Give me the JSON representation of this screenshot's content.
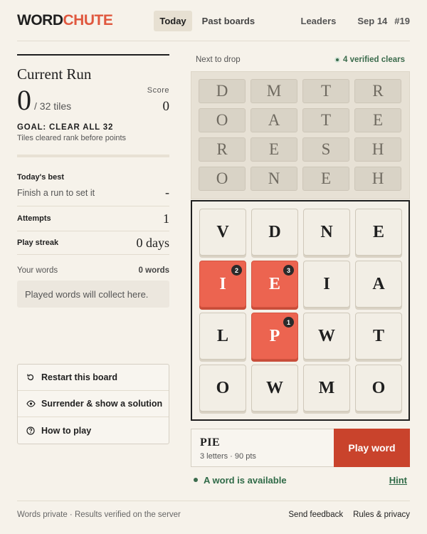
{
  "brand": {
    "word": "WORD",
    "chute": "CHUTE"
  },
  "nav": {
    "today": "Today",
    "past": "Past boards"
  },
  "header": {
    "leaders": "Leaders",
    "date": "Sep 14",
    "number": "#19"
  },
  "run": {
    "title": "Current Run",
    "cleared": "0",
    "of_total": "/ 32 tiles",
    "score_label": "Score",
    "score": "0",
    "goal": "GOAL: CLEAR ALL 32",
    "goal_sub": "Tiles cleared rank before points",
    "progress": 0
  },
  "stats": {
    "best_label": "Today's best",
    "best_sub": "Finish a run to set it",
    "best_value": "-",
    "attempts_label": "Attempts",
    "attempts_value": "1",
    "streak_label": "Play streak",
    "streak_value": "0 days"
  },
  "words": {
    "label": "Your words",
    "count": "0 words",
    "empty": "Played words will collect here."
  },
  "actions": [
    {
      "label": "Restart this board",
      "icon": "restart-icon"
    },
    {
      "label": "Surrender & show a solution",
      "icon": "eye-icon"
    },
    {
      "label": "How to play",
      "icon": "help-icon"
    }
  ],
  "drop": {
    "label": "Next to drop",
    "verified": "4 verified clears"
  },
  "queue": [
    [
      "D",
      "M",
      "T",
      "R"
    ],
    [
      "O",
      "A",
      "T",
      "E"
    ],
    [
      "R",
      "E",
      "S",
      "H"
    ],
    [
      "O",
      "N",
      "E",
      "H"
    ]
  ],
  "board": [
    [
      {
        "l": "V"
      },
      {
        "l": "D"
      },
      {
        "l": "N"
      },
      {
        "l": "E"
      }
    ],
    [
      {
        "l": "I",
        "sel": 2
      },
      {
        "l": "E",
        "sel": 3
      },
      {
        "l": "I"
      },
      {
        "l": "A"
      }
    ],
    [
      {
        "l": "L"
      },
      {
        "l": "P",
        "sel": 1
      },
      {
        "l": "W"
      },
      {
        "l": "T"
      }
    ],
    [
      {
        "l": "O"
      },
      {
        "l": "W"
      },
      {
        "l": "M"
      },
      {
        "l": "O"
      }
    ]
  ],
  "current_word": {
    "word": "PIE",
    "meta": "3 letters · 90 pts",
    "play_label": "Play word"
  },
  "availability": {
    "text": "A word is available",
    "hint": "Hint"
  },
  "colors": {
    "accent": "#e0583f",
    "play": "#c9432c",
    "selected": "#ec6450",
    "green": "#2f6a47"
  },
  "footer": {
    "note": "Words private · Results verified on the server",
    "feedback": "Send feedback",
    "rules": "Rules & privacy"
  }
}
